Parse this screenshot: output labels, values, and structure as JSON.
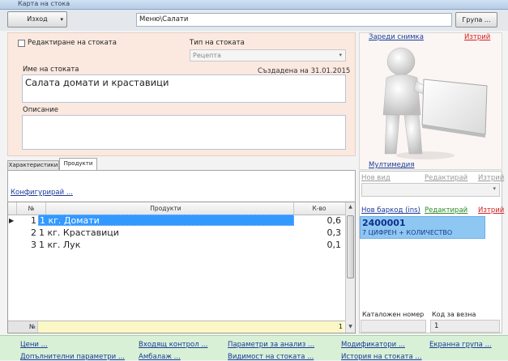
{
  "window": {
    "title": "Карта на стока"
  },
  "toolbar": {
    "exit_label": "Изход",
    "path": "Меню\\Салати",
    "group_label": "Група ..."
  },
  "form": {
    "edit_checkbox_label": "Редактиране на стоката",
    "type_label": "Тип на стоката",
    "type_value": "Рецепта",
    "name_label": "Име на стоката",
    "created_label": "Създадена на 31.01.2015",
    "name_value": "Салата домати и краставици",
    "description_label": "Описание",
    "description_value": ""
  },
  "image_panel": {
    "load_image": "Зареди снимка",
    "delete": "Изтрий",
    "multimedia": "Мултимедия"
  },
  "tabs": [
    {
      "label": "Характеристики"
    },
    {
      "label": "Продукти"
    }
  ],
  "products": {
    "configure_link": "Конфигурирай ...",
    "columns": {
      "num": "№",
      "product": "Продукти",
      "qty": "К-во"
    },
    "rows": [
      {
        "num": "1",
        "product": "1 кг. Домати",
        "qty": "0,6"
      },
      {
        "num": "2",
        "product": "1 кг. Краставици",
        "qty": "0,3"
      },
      {
        "num": "3",
        "product": "1 кг. Лук",
        "qty": "0,1"
      }
    ],
    "footer": {
      "num": "№",
      "qty": "1"
    }
  },
  "variants": {
    "new_type": "Нов вид",
    "edit": "Редактирай",
    "delete": "Изтрий"
  },
  "barcodes": {
    "new_barcode": "Нов баркод (ins)",
    "edit": "Редактирай",
    "delete": "Изтрий",
    "code": "2400001",
    "description": "7 ЦИФРЕН + КОЛИЧЕСТВО"
  },
  "catalog": {
    "catalog_number_label": "Каталожен номер",
    "catalog_number_value": "",
    "scale_code_label": "Код за везна",
    "scale_code_value": "1"
  },
  "bottom_links": {
    "row1": [
      "Цени ...",
      "Входящ контрол ...",
      "Параметри за анализ ...",
      "Модификатори ...",
      "Екранна група ..."
    ],
    "row2": [
      "Допълнителни параметри ...",
      "Амбалаж ...",
      "Видимост на стоката ...",
      "История на стоката ..."
    ]
  },
  "colors": {
    "selection": "#3399ff",
    "barcode_bg": "#8fc7f3",
    "peach": "#fbe9e0",
    "link": "#1a3a99",
    "delete": "#d32020",
    "edit_green": "#2a8a2a"
  }
}
